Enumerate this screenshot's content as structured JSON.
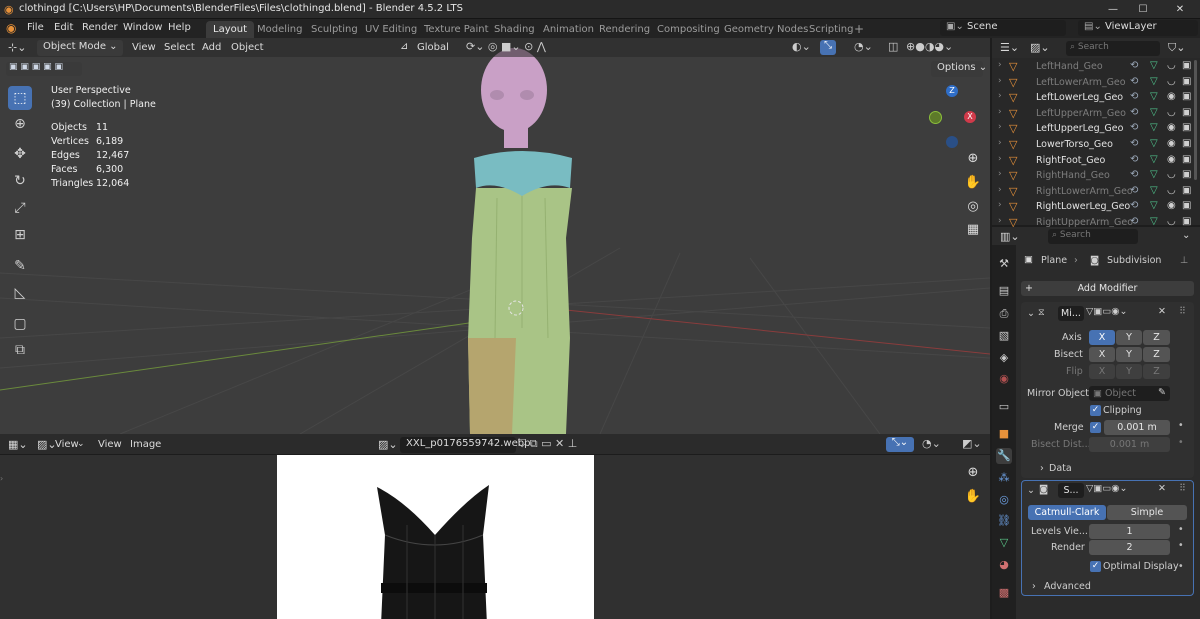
{
  "window": {
    "title": "clothingd [C:\\Users\\HP\\Documents\\BlenderFiles\\Files\\clothingd.blend] - Blender 4.5.2 LTS",
    "min": "—",
    "max": "☐",
    "close": "✕"
  },
  "menus": [
    "File",
    "Edit",
    "Render",
    "Window",
    "Help"
  ],
  "workspaces": [
    "Layout",
    "Modeling",
    "Sculpting",
    "UV Editing",
    "Texture Paint",
    "Shading",
    "Animation",
    "Rendering",
    "Compositing",
    "Geometry Nodes",
    "Scripting"
  ],
  "workspace_add": "+",
  "scene": {
    "label": "Scene",
    "view_layer": "ViewLayer"
  },
  "viewport": {
    "mode": "Object Mode",
    "menu": [
      "View",
      "Select",
      "Add",
      "Object"
    ],
    "orientation": "Global",
    "options": "Options",
    "view_name": "User Perspective",
    "collection": "(39) Collection | Plane",
    "stats": [
      [
        "Objects",
        "11"
      ],
      [
        "Vertices",
        "6,189"
      ],
      [
        "Edges",
        "12,467"
      ],
      [
        "Faces",
        "6,300"
      ],
      [
        "Triangles",
        "12,064"
      ]
    ],
    "gizmo": {
      "z": "Z",
      "x": "X"
    }
  },
  "image_editor": {
    "menu": [
      "View",
      "View",
      "Image"
    ],
    "filename": "XXL_p0176559742.webp"
  },
  "outliner": {
    "search": "Search",
    "items": [
      {
        "name": "LeftHand_Geo",
        "dim": true
      },
      {
        "name": "LeftLowerArm_Geo",
        "dim": true
      },
      {
        "name": "LeftLowerLeg_Geo",
        "dim": false
      },
      {
        "name": "LeftUpperArm_Geo",
        "dim": true
      },
      {
        "name": "LeftUpperLeg_Geo",
        "dim": false
      },
      {
        "name": "LowerTorso_Geo",
        "dim": false
      },
      {
        "name": "RightFoot_Geo",
        "dim": false
      },
      {
        "name": "RightHand_Geo",
        "dim": true
      },
      {
        "name": "RightLowerArm_Geo",
        "dim": true
      },
      {
        "name": "RightLowerLeg_Geo",
        "dim": false
      },
      {
        "name": "RightUpperArm_Geo",
        "dim": true
      }
    ]
  },
  "properties": {
    "search": "Search",
    "object": "Plane",
    "modifier_crumb": "Subdivision",
    "add_modifier": "Add Modifier",
    "mirror": {
      "name": "Mi...",
      "axis_label": "Axis",
      "bisect_label": "Bisect",
      "flip_label": "Flip",
      "x": "X",
      "y": "Y",
      "z": "Z",
      "mirror_object_label": "Mirror Object",
      "mirror_object_placeholder": "Object",
      "clipping": "Clipping",
      "merge_label": "Merge",
      "merge_value": "0.001 m",
      "bisect_dist_label": "Bisect Dist...",
      "bisect_dist_value": "0.001 m",
      "data": "Data"
    },
    "subsurf": {
      "name": "S...",
      "catmull": "Catmull-Clark",
      "simple": "Simple",
      "levels_label": "Levels Vie...",
      "levels_value": "1",
      "render_label": "Render",
      "render_value": "2",
      "optimal": "Optimal Display",
      "advanced": "Advanced"
    }
  }
}
